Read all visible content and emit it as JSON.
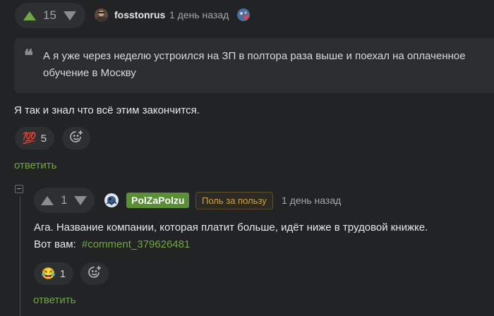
{
  "comment1": {
    "rating": "15",
    "username": "fosstonrus",
    "time": "1 день назад",
    "quote": "А я уже через неделю устроился на ЗП в полтора раза выше и поехал на оплаченное обучение в Москву",
    "text": "Я так и знал что всё этим закончится.",
    "reaction_emoji": "💯",
    "reaction_count": "5",
    "reply_label": "ответить",
    "colors": {
      "upvote_active": "#70a742"
    }
  },
  "comment2": {
    "rating": "1",
    "username": "PolZaPolzu",
    "award": "Поль за пользу",
    "time": "1 день назад",
    "text_line1": "Ага. Название компании, которая платит больше, идёт ниже в трудовой книжке.",
    "text_line2_prefix": "Вот вам:",
    "comment_link": "#comment_379626481",
    "reaction_emoji": "😂",
    "reaction_count": "1",
    "reply_label": "ответить"
  },
  "icons": {
    "upvote": "arrow-up-icon",
    "downvote": "arrow-down-icon",
    "add_reaction": "add-emoji-icon",
    "collapse": "collapse-thread-icon",
    "badge": "heart-badge-icon"
  }
}
